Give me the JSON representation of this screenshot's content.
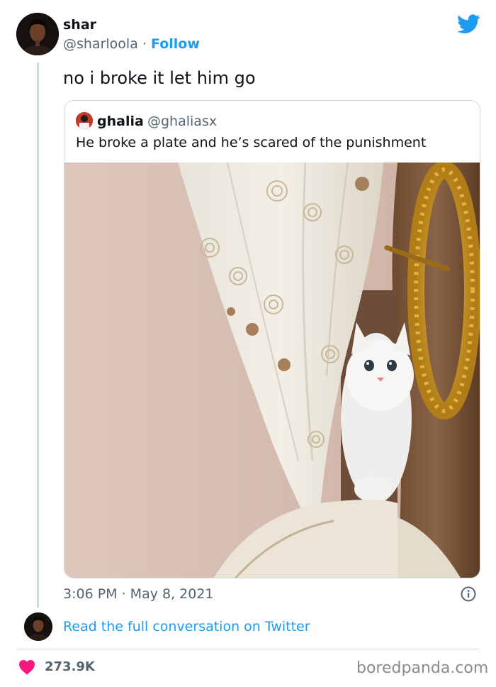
{
  "author": {
    "name": "shar",
    "handle": "@sharloola",
    "separator": " · ",
    "follow_label": "Follow"
  },
  "tweet": {
    "text": "no i broke it let him go",
    "timestamp": "3:06 PM · May 8, 2021"
  },
  "quoted_tweet": {
    "name": "ghalia",
    "handle": "@ghaliasx",
    "text": "He broke a plate and he’s scared of the punishment"
  },
  "footer": {
    "read_link": "Read the full conversation on Twitter",
    "like_count": "273.9K",
    "watermark": "boredpanda.com"
  },
  "colors": {
    "accent": "#1d9bf0",
    "heart": "#f91880",
    "secondary_text": "#536471"
  },
  "icons": [
    "twitter-bird-icon",
    "info-icon",
    "heart-icon"
  ]
}
